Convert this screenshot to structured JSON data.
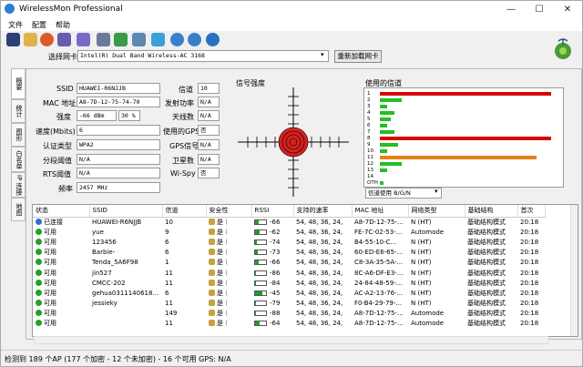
{
  "window": {
    "title": "WirelessMon Professional",
    "minimize": "—",
    "maximize": "☐",
    "close": "✕"
  },
  "menu": [
    "文件",
    "配置",
    "帮助"
  ],
  "adapter": {
    "label": "选择网卡",
    "value": "Intel(R) Dual Band Wireless-AC 3168",
    "reload": "重新加载网卡"
  },
  "tabs": [
    "概要",
    "统计",
    "图形",
    "白名单",
    "IP 连接",
    "地图"
  ],
  "info": {
    "ssid_label": "SSID",
    "ssid": "HUAWEI-R6NJJB",
    "mac_label": "MAC 地址",
    "mac": "A8-7D-12-75-74-70",
    "strength_label": "强度",
    "strength_dbm": "-66 dBm",
    "strength_pct": "30 %",
    "speed_label": "速度(Mbits)",
    "speed": "6",
    "auth_label": "认证类型",
    "auth": "WPA2",
    "frag_label": "分段阈值",
    "frag": "N/A",
    "rts_label": "RTS阈值",
    "rts": "N/A",
    "freq_label": "频率",
    "freq": "2457 MHz",
    "channel_label": "信道",
    "channel": "10",
    "txpower_label": "发射功率",
    "txpower": "N/A",
    "antenna_label": "天线数",
    "antenna": "N/A",
    "encrypt_label": "使用的GPS",
    "encrypt": "否",
    "gps_label": "GPS信号",
    "gps": "N/A",
    "sat_label": "卫星数",
    "sat": "N/A",
    "wispy_label": "Wi-Spy",
    "wispy": "否"
  },
  "signal": {
    "title": "信号强度"
  },
  "channels": {
    "title": "使用的信道",
    "labels": [
      "1",
      "2",
      "3",
      "4",
      "5",
      "6",
      "7",
      "8",
      "9",
      "10",
      "11",
      "12",
      "13",
      "14",
      "OTH"
    ],
    "values": [
      0.96,
      0.12,
      0.04,
      0.08,
      0.06,
      0.04,
      0.08,
      0.96,
      0.1,
      0.04,
      0.88,
      0.12,
      0.04,
      0.0,
      0.02
    ],
    "colors": [
      "#d80000",
      "#22c022",
      "#22c022",
      "#22c022",
      "#22c022",
      "#22c022",
      "#22c022",
      "#d80000",
      "#22c022",
      "#22c022",
      "#e8801a",
      "#22c022",
      "#22c022",
      "#22c022",
      "#22c022"
    ],
    "mode": "信道使用 B/G/N"
  },
  "table": {
    "headers": [
      "状态",
      "SSID",
      "信道",
      "安全性",
      "RSSI",
      "支持的速率",
      "MAC 地址",
      "网络类型",
      "基础结构",
      "首次"
    ],
    "rows": [
      {
        "status": "已连接",
        "ssid": "HUAWEI-R6NJJB",
        "ch": "10",
        "sec": "是",
        "rssi": "-66",
        "rssi_frac": 0.35,
        "rates": "54, 48, 36, 24,",
        "mac": "A8-7D-12-75-...",
        "type": "N (HT)",
        "infra": "基础结构模式",
        "first": "20:18",
        "color": "#2a6fd1"
      },
      {
        "status": "可用",
        "ssid": "yue",
        "ch": "9",
        "sec": "是",
        "rssi": "-62",
        "rssi_frac": 0.4,
        "rates": "54, 48, 36, 24,",
        "mac": "FE-7C-02-53-...",
        "type": "Automode",
        "infra": "基础结构模式",
        "first": "20:18",
        "color": "#22a022"
      },
      {
        "status": "可用",
        "ssid": "123456",
        "ch": "6",
        "sec": "是",
        "rssi": "-74",
        "rssi_frac": 0.2,
        "rates": "54, 48, 36, 24,",
        "mac": "B4-55-10-C...",
        "type": "N (HT)",
        "infra": "基础结构模式",
        "first": "20:18",
        "color": "#22a022"
      },
      {
        "status": "可用",
        "ssid": "Barbie-",
        "ch": "6",
        "sec": "是",
        "rssi": "-73",
        "rssi_frac": 0.22,
        "rates": "54, 48, 36, 24,",
        "mac": "60-ED-E6-65-...",
        "type": "N (HT)",
        "infra": "基础结构模式",
        "first": "20:18",
        "color": "#22a022"
      },
      {
        "status": "可用",
        "ssid": "Tenda_5A6F98",
        "ch": "1",
        "sec": "是",
        "rssi": "-66",
        "rssi_frac": 0.35,
        "rates": "54, 48, 36, 24,",
        "mac": "C8-3A-35-5A-...",
        "type": "N (HT)",
        "infra": "基础结构模式",
        "first": "20:18",
        "color": "#22a022"
      },
      {
        "status": "可用",
        "ssid": "jin527",
        "ch": "11",
        "sec": "是",
        "rssi": "-86",
        "rssi_frac": 0.05,
        "rates": "54, 48, 36, 24,",
        "mac": "8C-A6-DF-E3-...",
        "type": "N (HT)",
        "infra": "基础结构模式",
        "first": "20:18",
        "color": "#22a022"
      },
      {
        "status": "可用",
        "ssid": "CMCC-202",
        "ch": "11",
        "sec": "是",
        "rssi": "-84",
        "rssi_frac": 0.06,
        "rates": "54, 48, 36, 24,",
        "mac": "24-84-48-59-...",
        "type": "N (HT)",
        "infra": "基础结构模式",
        "first": "20:18",
        "color": "#22a022"
      },
      {
        "status": "可用",
        "ssid": "gehua0311140618...",
        "ch": "6",
        "sec": "是",
        "rssi": "-45",
        "rssi_frac": 0.7,
        "rates": "54, 48, 36, 24,",
        "mac": "AC-A2-13-76-...",
        "type": "N (HT)",
        "infra": "基础结构模式",
        "first": "20:18",
        "color": "#22a022"
      },
      {
        "status": "可用",
        "ssid": "jessieky",
        "ch": "11",
        "sec": "是",
        "rssi": "-79",
        "rssi_frac": 0.12,
        "rates": "54, 48, 36, 24,",
        "mac": "F0-B4-29-79-...",
        "type": "N (HT)",
        "infra": "基础结构模式",
        "first": "20:18",
        "color": "#22a022"
      },
      {
        "status": "可用",
        "ssid": "",
        "ch": "149",
        "sec": "是",
        "rssi": "-88",
        "rssi_frac": 0.04,
        "rates": "54, 48, 36, 24,",
        "mac": "A8-7D-12-75-...",
        "type": "Automode",
        "infra": "基础结构模式",
        "first": "20:18",
        "color": "#22a022"
      },
      {
        "status": "可用",
        "ssid": "",
        "ch": "11",
        "sec": "是",
        "rssi": "-64",
        "rssi_frac": 0.38,
        "rates": "54, 48, 36, 24,",
        "mac": "A8-7D-12-75-...",
        "type": "Automode",
        "infra": "基础结构模式",
        "first": "20:18",
        "color": "#22a022"
      }
    ]
  },
  "status": "检测到 189 个AP (177 个加密 - 12 个未加密) - 16 个可用 GPS: N/A"
}
